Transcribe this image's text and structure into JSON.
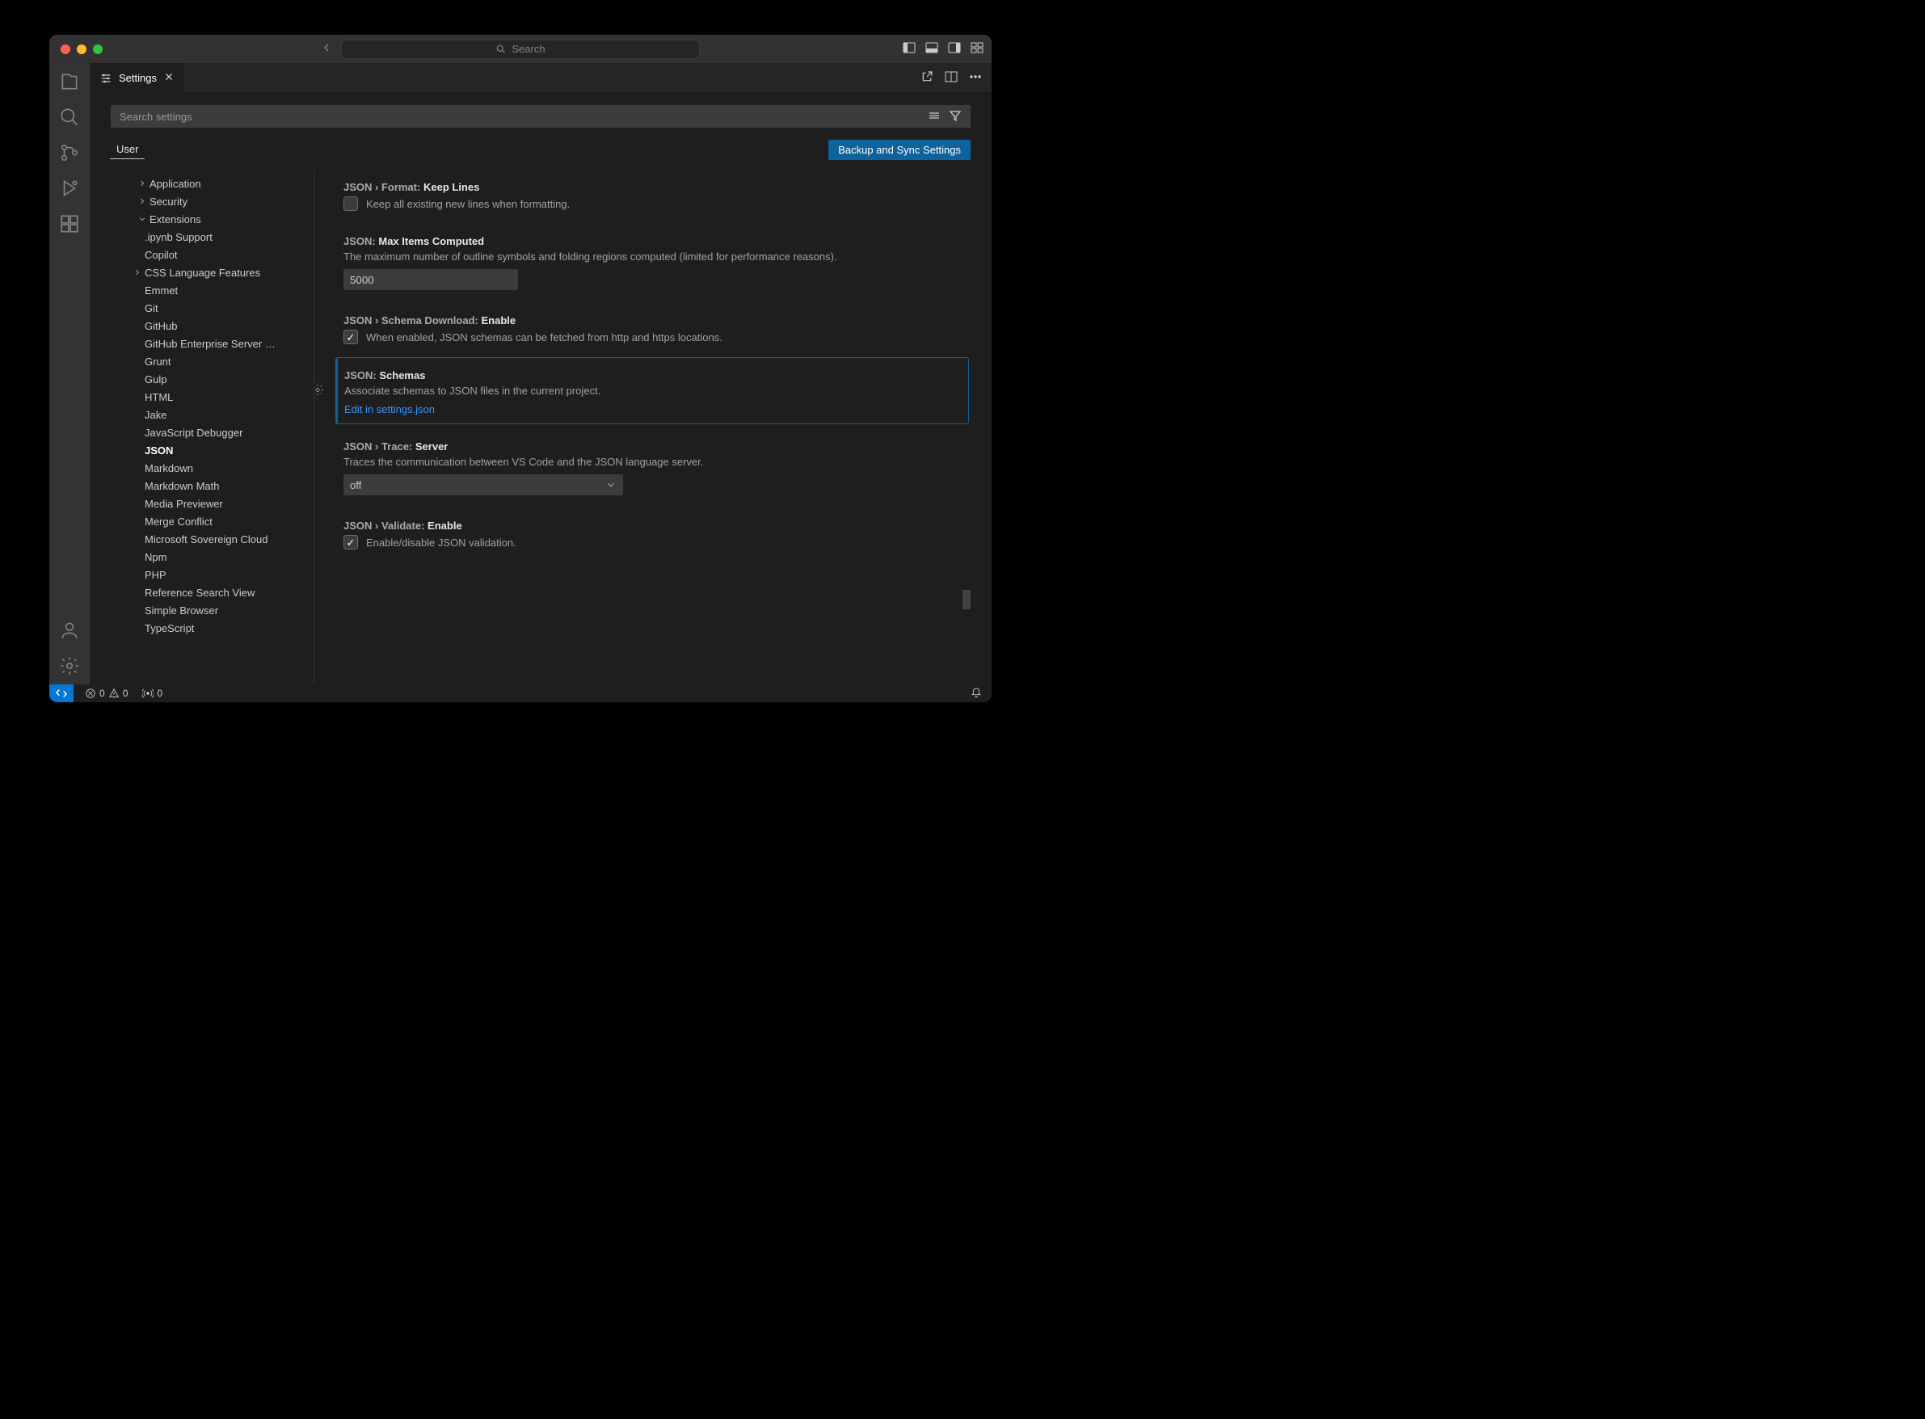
{
  "titlebar": {
    "search_placeholder": "Search"
  },
  "tab": {
    "label": "Settings"
  },
  "search": {
    "placeholder": "Search settings"
  },
  "scope": {
    "user": "User"
  },
  "sync_button": "Backup and Sync Settings",
  "toc": {
    "application": "Application",
    "security": "Security",
    "extensions": "Extensions",
    "items": [
      ".ipynb Support",
      "Copilot",
      "CSS Language Features",
      "Emmet",
      "Git",
      "GitHub",
      "GitHub Enterprise Server …",
      "Grunt",
      "Gulp",
      "HTML",
      "Jake",
      "JavaScript Debugger",
      "JSON",
      "Markdown",
      "Markdown Math",
      "Media Previewer",
      "Merge Conflict",
      "Microsoft Sovereign Cloud",
      "Npm",
      "PHP",
      "Reference Search View",
      "Simple Browser",
      "TypeScript"
    ]
  },
  "settings": {
    "keepLines": {
      "prefix": "JSON › Format:",
      "name": "Keep Lines",
      "desc": "Keep all existing new lines when formatting."
    },
    "maxItems": {
      "prefix": "JSON:",
      "name": "Max Items Computed",
      "desc": "The maximum number of outline symbols and folding regions computed (limited for performance reasons).",
      "value": "5000"
    },
    "schemaDownload": {
      "prefix": "JSON › Schema Download:",
      "name": "Enable",
      "desc": "When enabled, JSON schemas can be fetched from http and https locations."
    },
    "schemas": {
      "prefix": "JSON:",
      "name": "Schemas",
      "desc": "Associate schemas to JSON files in the current project.",
      "link": "Edit in settings.json"
    },
    "trace": {
      "prefix": "JSON › Trace:",
      "name": "Server",
      "desc": "Traces the communication between VS Code and the JSON language server.",
      "value": "off"
    },
    "validate": {
      "prefix": "JSON › Validate:",
      "name": "Enable",
      "desc": "Enable/disable JSON validation."
    }
  },
  "statusbar": {
    "errors": "0",
    "warnings": "0",
    "ports": "0"
  }
}
